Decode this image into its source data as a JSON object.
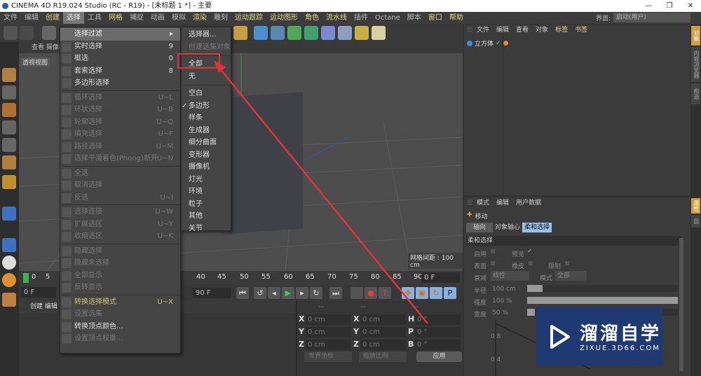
{
  "title": "CINEMA 4D R19.024 Studio (RC - R19) - [未标题 1 *] - 主要",
  "window_buttons": [
    "—",
    "❐",
    "✕"
  ],
  "menubar": [
    {
      "label": "文件"
    },
    {
      "label": "编辑"
    },
    {
      "label": "创建",
      "y": true
    },
    {
      "label": "选择",
      "active": true
    },
    {
      "label": "工具"
    },
    {
      "label": "网格",
      "y": true
    },
    {
      "label": "捕捉"
    },
    {
      "label": "动画"
    },
    {
      "label": "模拟"
    },
    {
      "label": "渲染",
      "y": true
    },
    {
      "label": "雕刻"
    },
    {
      "label": "运动跟踪",
      "y": true
    },
    {
      "label": "运动图形",
      "y": true
    },
    {
      "label": "角色",
      "y": true
    },
    {
      "label": "流水线",
      "y": true
    },
    {
      "label": "插件"
    },
    {
      "label": "Octane"
    },
    {
      "label": "脚本"
    },
    {
      "label": "窗口",
      "y": true
    },
    {
      "label": "帮助",
      "y": true
    }
  ],
  "layout": {
    "label": "界面:",
    "value": "启动(用户)"
  },
  "viewport": {
    "header": "查看  摄像机",
    "label": "透视视图",
    "grid": "网格间距 : 100 cm"
  },
  "timeline": {
    "ticks": [
      "0",
      "5",
      "40",
      "45",
      "50",
      "55",
      "60",
      "65",
      "70",
      "75",
      "80",
      "85",
      "90"
    ],
    "frame": "0 F"
  },
  "controls": {
    "start": "0 F",
    "end": "90 F"
  },
  "bottom_tabs": "创建  编辑",
  "coords": {
    "header": [
      "--",
      "--",
      "--"
    ],
    "rows": [
      [
        "X",
        "0 cm",
        "X",
        "0 cm",
        "H",
        "0 °"
      ],
      [
        "Y",
        "0 cm",
        "Y",
        "0 cm",
        "P",
        "0 °"
      ],
      [
        "Z",
        "0 cm",
        "Z",
        "0 cm",
        "B",
        "0 °"
      ]
    ],
    "dd1": "世界坐标",
    "dd2": "缩放比例",
    "apply": "应用"
  },
  "object_panel": {
    "tabs": [
      "文件",
      "编辑",
      "查看",
      "对象",
      "标签",
      "书签"
    ],
    "object": "立方体"
  },
  "attr_panel": {
    "tabs": [
      "模式",
      "编辑",
      "用户数据"
    ],
    "tool": "移动",
    "subtabs": [
      "轴向",
      "对象轴心",
      "柔和选择"
    ],
    "section": "柔和选择",
    "enable": "启用",
    "preview": "预览",
    "surface": "表面",
    "rubber": "橡皮",
    "restrict": "限制",
    "falloff_label": "衰减",
    "falloff": "线性",
    "mode_label": "模式",
    "mode": "全部",
    "radius_label": "半径",
    "radius": "100 cm",
    "strength_label": "强度",
    "strength": "100 %",
    "width_label": "宽度",
    "width": "50 %",
    "graph_y": [
      "0.8",
      "0.4"
    ]
  },
  "right_tabs": [
    "对象",
    "内容浏览器",
    "构造"
  ],
  "right_tabs2": [
    "属性",
    "层"
  ],
  "menu": {
    "items": [
      {
        "label": "选择过滤",
        "sc": "▸",
        "en": true,
        "top": true
      },
      {
        "label": "实时选择",
        "sc": "9",
        "en": true
      },
      {
        "label": "框选",
        "sc": "0",
        "en": true
      },
      {
        "label": "套索选择",
        "sc": "8",
        "en": true
      },
      {
        "label": "多边形选择",
        "sc": "",
        "en": true,
        "sep": true
      },
      {
        "label": "循环选择",
        "sc": "U~L"
      },
      {
        "label": "环状选择",
        "sc": "U~B"
      },
      {
        "label": "轮廓选择",
        "sc": "U~Q"
      },
      {
        "label": "填充选择",
        "sc": "U~F"
      },
      {
        "label": "路径选择",
        "sc": "U~M"
      },
      {
        "label": "选择平滑着色(Phong)断开",
        "sc": "U~N",
        "sep": true
      },
      {
        "label": "全选",
        "sc": ""
      },
      {
        "label": "取消选择",
        "sc": ""
      },
      {
        "label": "反选",
        "sc": "U~I",
        "sep": true
      },
      {
        "label": "选择连接",
        "sc": "U~W"
      },
      {
        "label": "扩展选区",
        "sc": "U~Y"
      },
      {
        "label": "收缩选区",
        "sc": "U~K",
        "sep": true
      },
      {
        "label": "隐藏选择",
        "sc": ""
      },
      {
        "label": "隐藏未选择",
        "sc": ""
      },
      {
        "label": "全部显示",
        "sc": ""
      },
      {
        "label": "反转显示",
        "sc": "",
        "sep": true
      },
      {
        "label": "转换选择模式",
        "sc": "U~X",
        "hl": true
      },
      {
        "label": "设置选集",
        "sc": ""
      },
      {
        "label": "转换顶点颜色...",
        "sc": "",
        "en": true
      },
      {
        "label": "设置顶点权重...",
        "sc": ""
      }
    ]
  },
  "submenu": {
    "items": [
      {
        "label": "选择器...",
        "en": true
      },
      {
        "label": "创建选集对象"
      },
      {
        "label": "全部",
        "en": true,
        "gap": true
      },
      {
        "label": "无",
        "en": true
      },
      {
        "label": "空白",
        "en": true,
        "gap": true
      },
      {
        "label": "多边形",
        "en": true,
        "check": "✓"
      },
      {
        "label": "样条",
        "en": true
      },
      {
        "label": "生成器",
        "en": true
      },
      {
        "label": "细分曲面",
        "en": true
      },
      {
        "label": "变形器",
        "en": true
      },
      {
        "label": "摄像机",
        "en": true
      },
      {
        "label": "灯光",
        "en": true
      },
      {
        "label": "环境",
        "en": true
      },
      {
        "label": "粒子",
        "en": true
      },
      {
        "label": "其他",
        "en": true
      },
      {
        "label": "关节",
        "en": true
      }
    ]
  },
  "watermark": {
    "name": "溜溜自学",
    "url": "ZIXUE.3D66.COM"
  },
  "colors": {
    "highlight_box": "#e03434",
    "menu_yellow": "#e6d98a",
    "watermark_bg": "#1f3a73"
  }
}
